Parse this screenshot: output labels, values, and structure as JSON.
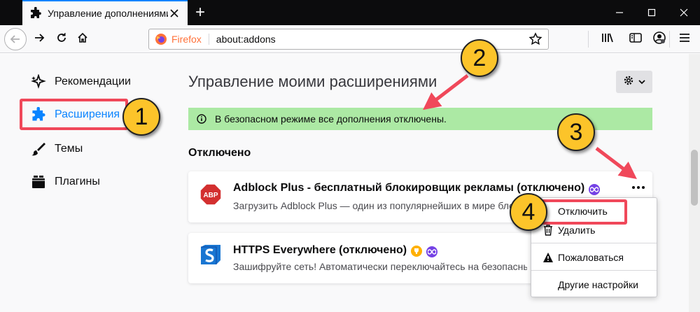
{
  "browser": {
    "tab_title": "Управление дополнениями",
    "new_tab_symbol": "+",
    "identity": "Firefox",
    "url": "about:addons"
  },
  "sidebar": {
    "items": [
      {
        "label": "Рекомендации",
        "icon": "sparkle-icon"
      },
      {
        "label": "Расширения",
        "icon": "puzzle-icon",
        "active": true
      },
      {
        "label": "Темы",
        "icon": "brush-icon"
      },
      {
        "label": "Плагины",
        "icon": "plugin-icon"
      }
    ]
  },
  "main": {
    "title": "Управление моими расширениями",
    "safe_mode_notice": "В безопасном режиме все дополнения отключены.",
    "section_heading": "Отключено",
    "addons": [
      {
        "name": "Adblock Plus - бесплатный блокировщик рекламы (отключено)",
        "description": "Загрузить Adblock Plus — один из популярнейших в мире блокировщиков рекламы",
        "icon_text": "ABP"
      },
      {
        "name": "HTTPS Everywhere (отключено)",
        "description": "Зашифруйте сеть! Автоматически переключайтесь на безопасный протокол HTTPS"
      }
    ]
  },
  "context_menu": {
    "items": [
      "Отключить",
      "Удалить",
      "Пожаловаться",
      "Другие настройки"
    ]
  },
  "annotations": [
    "1",
    "2",
    "3",
    "4"
  ],
  "colors": {
    "accent": "#0a84ff",
    "highlight": "#f0485a",
    "callout": "#fcc42a",
    "banner": "#ace9a4",
    "firefox": "#ff7139"
  }
}
